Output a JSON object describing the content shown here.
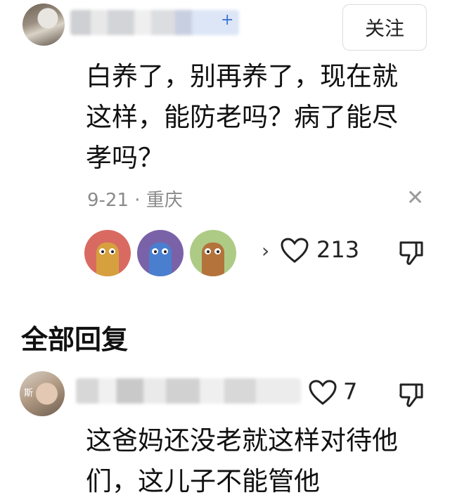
{
  "comment": {
    "follow_label": "关注",
    "text": "白养了，别再养了，现在就这样，能防老吗？病了能尽孝吗？",
    "date": "9-21",
    "separator": "·",
    "location": "重庆",
    "close_icon": "close-icon",
    "reactions_more": "›",
    "like_count": "213",
    "plus_mark": "+"
  },
  "section": {
    "title": "全部回复"
  },
  "reply": {
    "avatar_tag": "斯",
    "like_count": "7",
    "text": "这爸妈还没老就这样对待他们，这儿子不能管他"
  },
  "icons": {
    "like": "heart-outline-icon",
    "dislike": "thumbs-down-icon"
  },
  "colors": {
    "text": "#111111",
    "meta": "#8a8a8a",
    "follow_border": "#dcdcdc",
    "accent": "#3b73d1"
  }
}
